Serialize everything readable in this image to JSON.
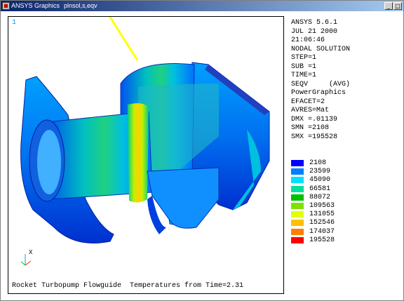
{
  "window": {
    "title": "ANSYS Graphics",
    "command": "plnsol,s,eqv",
    "minimize_glyph": "_",
    "maximize_glyph": "□"
  },
  "viewport": {
    "window_number": "1",
    "caption": "Rocket Turbopump Flowguide  Temperatures from Time=2.31",
    "axis_label": "X"
  },
  "info_panel": [
    "ANSYS 5.6.1",
    "JUL 21 2000",
    "21:06:46",
    "NODAL SOLUTION",
    "STEP=1",
    "SUB =1",
    "TIME=1",
    "SEQV     (AVG)",
    "PowerGraphics",
    "EFACET=2",
    "AVRES=Mat",
    "DMX =.01139",
    "SMN =2108",
    "SMX =195528"
  ],
  "legend": [
    {
      "value": "2108",
      "color": "#0000ff"
    },
    {
      "value": "23599",
      "color": "#0080ff"
    },
    {
      "value": "45090",
      "color": "#00e0ff"
    },
    {
      "value": "66581",
      "color": "#00e0a0"
    },
    {
      "value": "88072",
      "color": "#00c000"
    },
    {
      "value": "109563",
      "color": "#80e000"
    },
    {
      "value": "131055",
      "color": "#e0ff00"
    },
    {
      "value": "152546",
      "color": "#ffc000"
    },
    {
      "value": "174037",
      "color": "#ff8000"
    },
    {
      "value": "195528",
      "color": "#ff0000"
    }
  ]
}
